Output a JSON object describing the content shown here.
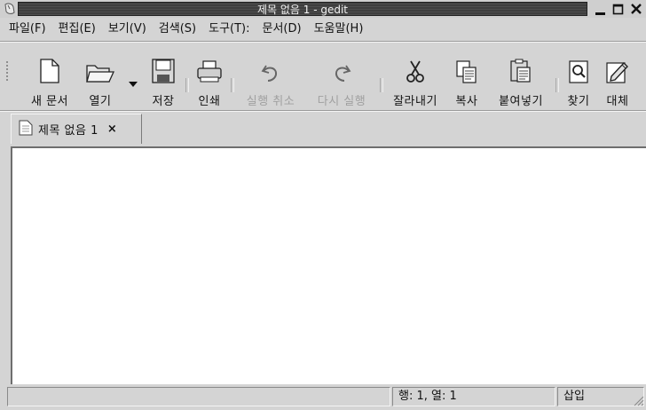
{
  "window": {
    "title": "제목 없음 1 - gedit",
    "app_icon": "mouse-icon",
    "controls": [
      "minimize-icon",
      "maximize-icon",
      "close-icon"
    ]
  },
  "menubar": {
    "items": [
      {
        "label": "파일(F)",
        "mnemonic": "F"
      },
      {
        "label": "편집(E)",
        "mnemonic": "E"
      },
      {
        "label": "보기(V)",
        "mnemonic": "V"
      },
      {
        "label": "검색(S)",
        "mnemonic": "S"
      },
      {
        "label": "도구(T):",
        "mnemonic": "T"
      },
      {
        "label": "문서(D)",
        "mnemonic": "D"
      },
      {
        "label": "도움말(H)",
        "mnemonic": "H"
      }
    ]
  },
  "toolbar": {
    "new_label": "새 문서",
    "open_label": "열기",
    "save_label": "저장",
    "print_label": "인쇄",
    "undo_label": "실행 취소",
    "redo_label": "다시 실행",
    "cut_label": "잘라내기",
    "copy_label": "복사",
    "paste_label": "붙여넣기",
    "find_label": "찾기",
    "replace_label": "대체",
    "icons": [
      "new-document-icon",
      "open-folder-icon",
      "save-floppy-icon",
      "printer-icon",
      "undo-icon",
      "redo-icon",
      "cut-scissors-icon",
      "copy-icon",
      "paste-icon",
      "find-icon",
      "replace-icon"
    ],
    "disabled": [
      "undo",
      "redo"
    ]
  },
  "tabs": [
    {
      "label": "제목 없음 1",
      "close": "×",
      "icon": "document-icon"
    }
  ],
  "editor": {
    "content": ""
  },
  "statusbar": {
    "message": "",
    "position": "행: 1, 열: 1",
    "mode": "삽입"
  }
}
